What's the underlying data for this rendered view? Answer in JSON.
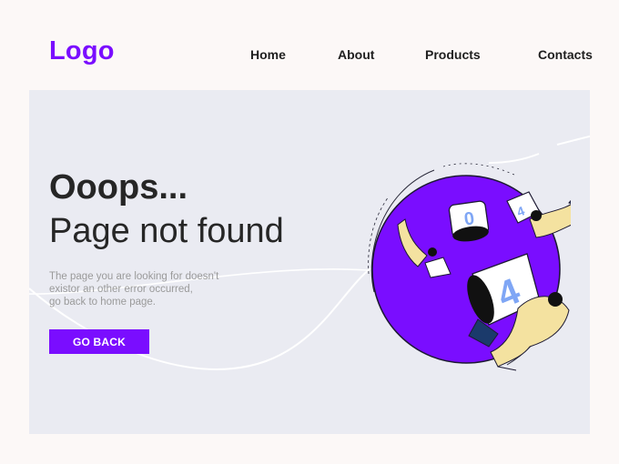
{
  "header": {
    "logo": "Logo",
    "nav": [
      {
        "label": "Home"
      },
      {
        "label": "About"
      },
      {
        "label": "Products"
      },
      {
        "label": "Contacts"
      }
    ]
  },
  "main": {
    "headline": "Ooops...",
    "subheadline": "Page not found",
    "description": [
      "The page you are looking for doesn't",
      "existor an other error occurred,",
      "go back to home page."
    ],
    "button_label": "GO BACK",
    "illustration": {
      "digits": [
        "0",
        "4"
      ]
    }
  },
  "colors": {
    "accent": "#7a0dff",
    "panel_bg": "#eaebf2",
    "page_bg": "#fcf8f7",
    "heading": "#262626",
    "muted_text": "#9a9a9a"
  },
  "icons": [
    "astronaut-icon",
    "cup-icon",
    "space-planet-icon"
  ]
}
